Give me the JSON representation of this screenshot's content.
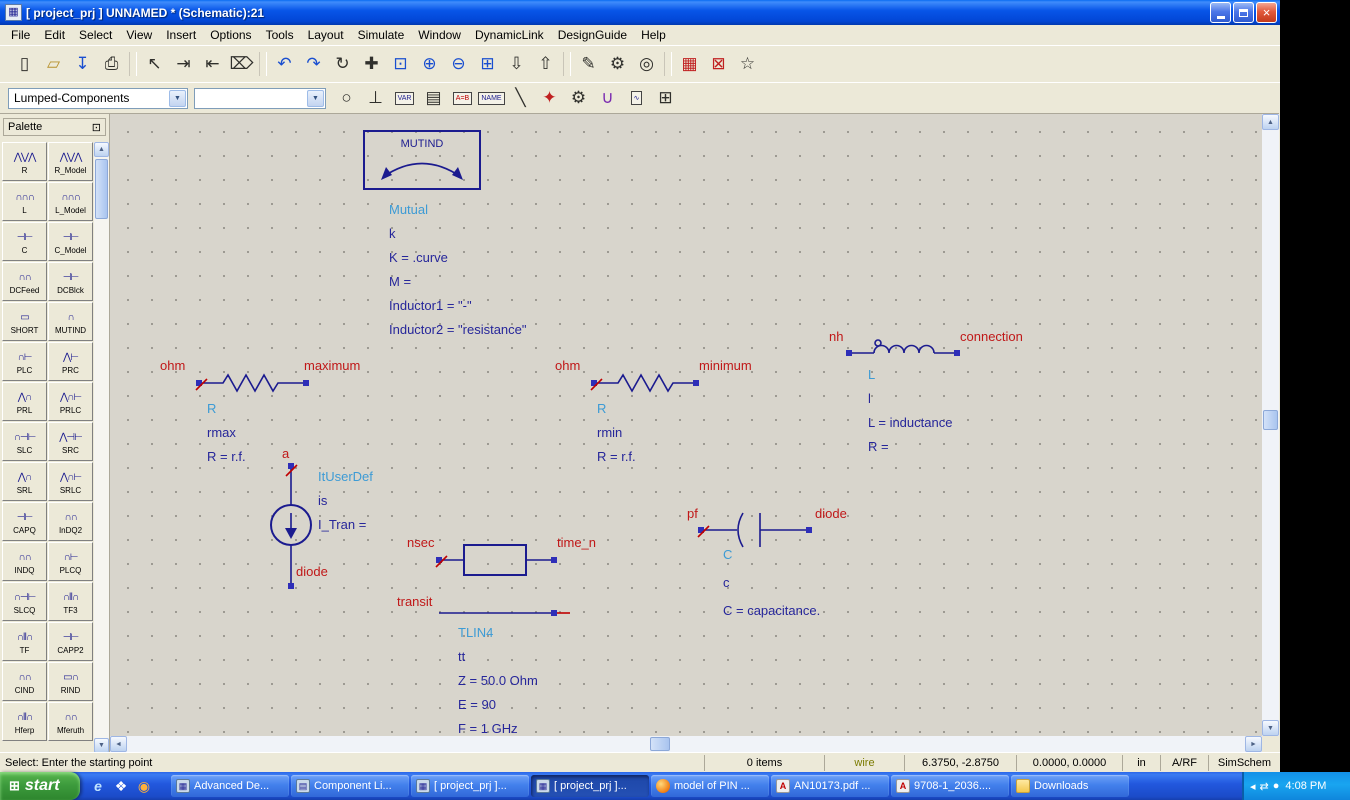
{
  "window": {
    "title": "[ project_prj ] UNNAMED * (Schematic):21"
  },
  "menu": {
    "items": [
      "File",
      "Edit",
      "Select",
      "View",
      "Insert",
      "Options",
      "Tools",
      "Layout",
      "Simulate",
      "Window",
      "DynamicLink",
      "DesignGuide",
      "Help"
    ]
  },
  "toolbar1": {
    "icons": [
      {
        "name": "new-design-icon",
        "glyph": "▯"
      },
      {
        "name": "open-design-icon",
        "glyph": "▱",
        "cls": "amber"
      },
      {
        "name": "save-design-icon",
        "glyph": "↧",
        "cls": "blue"
      },
      {
        "name": "print-icon",
        "glyph": "⎙"
      },
      {
        "name": "separator",
        "glyph": "",
        "cls": "sep"
      },
      {
        "name": "select-pointer-icon",
        "glyph": "↖"
      },
      {
        "name": "insert-pin-icon",
        "glyph": "⇥"
      },
      {
        "name": "insert-pin2-icon",
        "glyph": "⇤"
      },
      {
        "name": "delete-icon",
        "glyph": "⌦"
      },
      {
        "name": "separator",
        "glyph": "",
        "cls": "sep"
      },
      {
        "name": "undo-icon",
        "glyph": "↶",
        "cls": "blue"
      },
      {
        "name": "redo-icon",
        "glyph": "↷",
        "cls": "blue"
      },
      {
        "name": "rotate-icon",
        "glyph": "↻"
      },
      {
        "name": "move-icon",
        "glyph": "✚"
      },
      {
        "name": "zoom-area-icon",
        "glyph": "⊡",
        "cls": "blue"
      },
      {
        "name": "zoom-in-icon",
        "glyph": "⊕",
        "cls": "blue"
      },
      {
        "name": "zoom-out-icon",
        "glyph": "⊖",
        "cls": "blue"
      },
      {
        "name": "zoom-fit-icon",
        "glyph": "⊞",
        "cls": "blue"
      },
      {
        "name": "push-into-hierarchy-icon",
        "glyph": "⇩"
      },
      {
        "name": "pop-out-hierarchy-icon",
        "glyph": "⇧"
      },
      {
        "name": "separator",
        "glyph": "",
        "cls": "sep"
      },
      {
        "name": "insert-wire-icon",
        "glyph": "✎"
      },
      {
        "name": "simulate-icon",
        "glyph": "⚙"
      },
      {
        "name": "find-icon",
        "glyph": "◎"
      },
      {
        "name": "separator",
        "glyph": "",
        "cls": "sep"
      },
      {
        "name": "deactivate-component-icon",
        "glyph": "▦",
        "cls": "red"
      },
      {
        "name": "deactivate-delete-icon",
        "glyph": "⊠",
        "cls": "red"
      },
      {
        "name": "wand-icon",
        "glyph": "☆"
      }
    ]
  },
  "toolbar2": {
    "palette_combo": "Lumped-Components",
    "history_combo": "",
    "icons": [
      {
        "name": "oval-shape-icon",
        "glyph": "○"
      },
      {
        "name": "ground-icon",
        "glyph": "⊥"
      },
      {
        "name": "var-icon",
        "glyph": "VAR",
        "cls": "boxed"
      },
      {
        "name": "display-icon",
        "glyph": "▤"
      },
      {
        "name": "equation-icon",
        "glyph": "A=B",
        "cls": "boxedred"
      },
      {
        "name": "name-node-icon",
        "glyph": "NAME",
        "cls": "boxed"
      },
      {
        "name": "wire-icon",
        "glyph": "╲"
      },
      {
        "name": "port-icon",
        "glyph": "✦",
        "cls": "red"
      },
      {
        "name": "gear-icon",
        "glyph": "⚙"
      },
      {
        "name": "probe-icon",
        "glyph": "∪",
        "cls": "purple"
      },
      {
        "name": "wave-icon",
        "glyph": "∿",
        "cls": "boxed"
      },
      {
        "name": "library-browser-icon",
        "glyph": "⊞"
      }
    ]
  },
  "palette": {
    "title": "Palette",
    "items": [
      {
        "label": "R",
        "glyph": "⋀⋁⋀"
      },
      {
        "label": "R_Model",
        "glyph": "⋀⋁⋀"
      },
      {
        "label": "L",
        "glyph": "∩∩∩"
      },
      {
        "label": "L_Model",
        "glyph": "∩∩∩"
      },
      {
        "label": "C",
        "glyph": "⊣⊢"
      },
      {
        "label": "C_Model",
        "glyph": "⊣⊢"
      },
      {
        "label": "DCFeed",
        "glyph": "∩∩"
      },
      {
        "label": "DCBlck",
        "glyph": "⊣⊢"
      },
      {
        "label": "SHORT",
        "glyph": "▭"
      },
      {
        "label": "MUTIND",
        "glyph": "∩"
      },
      {
        "label": "PLC",
        "glyph": "∩⊢"
      },
      {
        "label": "PRC",
        "glyph": "⋀⊢"
      },
      {
        "label": "PRL",
        "glyph": "⋀∩"
      },
      {
        "label": "PRLC",
        "glyph": "⋀∩⊢"
      },
      {
        "label": "SLC",
        "glyph": "∩⊣⊢"
      },
      {
        "label": "SRC",
        "glyph": "⋀⊣⊢"
      },
      {
        "label": "SRL",
        "glyph": "⋀∩"
      },
      {
        "label": "SRLC",
        "glyph": "⋀∩⊢"
      },
      {
        "label": "CAPQ",
        "glyph": "⊣⊢"
      },
      {
        "label": "InDQ2",
        "glyph": "∩∩"
      },
      {
        "label": "INDQ",
        "glyph": "∩∩"
      },
      {
        "label": "PLCQ",
        "glyph": "∩⊢"
      },
      {
        "label": "SLCQ",
        "glyph": "∩⊣⊢"
      },
      {
        "label": "TF3",
        "glyph": "∩‖∩"
      },
      {
        "label": "TF",
        "glyph": "∩‖∩"
      },
      {
        "label": "CAPP2",
        "glyph": "⊣⊢"
      },
      {
        "label": "CIND",
        "glyph": "∩∩"
      },
      {
        "label": "RIND",
        "glyph": "▭∩"
      },
      {
        "label": "Hferp",
        "glyph": "∩‖∩"
      },
      {
        "label": "Mferuth",
        "glyph": "∩∩"
      }
    ]
  },
  "schematic": {
    "mutind": {
      "box_label": "MUTIND",
      "name": "Mutual",
      "lines": [
        "k",
        "K = .curve",
        "M =",
        "Inductor1 = \"-\"",
        "Inductor2 = \"resistance\""
      ]
    },
    "r1": {
      "pin_left": "ohm",
      "pin_right": "maximum",
      "name": "R",
      "lines": [
        "rmax",
        "R = r.f."
      ]
    },
    "r2": {
      "pin_left": "ohm",
      "pin_right": "minimum",
      "name": "R",
      "lines": [
        "rmin",
        "R = r.f."
      ]
    },
    "l1": {
      "pin_left": "nh",
      "pin_right": "connection",
      "name": "L",
      "lines": [
        "l",
        "L = inductance",
        "R ="
      ]
    },
    "isrc": {
      "pin_top": "a",
      "pin_bottom": "diode",
      "name": "ItUserDef",
      "lines": [
        "is",
        "I_Tran ="
      ]
    },
    "tlin": {
      "pin_left": "nsec",
      "pin_right": "time_n",
      "pin_left2": "transit",
      "name": "TLIN4",
      "lines": [
        "tt",
        "Z = 50.0 Ohm",
        "E = 90",
        "F = 1 GHz"
      ]
    },
    "c1": {
      "pin_left": "pf",
      "pin_right": "diode",
      "name": "C",
      "lines": [
        "c",
        "C = capacitance."
      ]
    }
  },
  "statusbar": {
    "message": "Select: Enter the starting point",
    "items": "0 items",
    "mode": "wire",
    "coord1": "6.3750, -2.8750",
    "coord2": "0.0000, 0.0000",
    "units": "in",
    "tech": "A/RF",
    "tool": "SimSchem"
  },
  "taskbar": {
    "start_label": "start",
    "start_flag": "⊞",
    "quicklaunch": [
      {
        "name": "quicklaunch-internet-explorer-icon",
        "glyph": "e",
        "cls": "ie"
      },
      {
        "name": "quicklaunch-app-icon",
        "glyph": "❖",
        "cls": ""
      },
      {
        "name": "quicklaunch-firefox-icon",
        "glyph": "◉",
        "cls": "orange"
      }
    ],
    "tasks": [
      {
        "label": "Advanced De...",
        "icon": "ads",
        "glyph": "▦",
        "state": ""
      },
      {
        "label": "Component Li...",
        "icon": "ads",
        "glyph": "▤",
        "state": ""
      },
      {
        "label": "[ project_prj ]...",
        "icon": "ads",
        "glyph": "▦",
        "state": ""
      },
      {
        "label": "[ project_prj ]...",
        "icon": "ads",
        "glyph": "▦",
        "state": "active"
      },
      {
        "label": "model of PIN ...",
        "icon": "firefox",
        "glyph": "",
        "state": ""
      },
      {
        "label": "AN10173.pdf ...",
        "icon": "pdf",
        "glyph": "A",
        "state": ""
      },
      {
        "label": "9708-1_2036....",
        "icon": "pdf",
        "glyph": "A",
        "state": ""
      },
      {
        "label": "Downloads",
        "icon": "folder",
        "glyph": "",
        "state": ""
      }
    ],
    "tray_icons": [
      {
        "name": "tray-hidden-icons-chevron",
        "glyph": "◂"
      },
      {
        "name": "tray-network-icon",
        "glyph": "⇄"
      },
      {
        "name": "tray-status-icon",
        "glyph": "●"
      }
    ],
    "time": "4:08 PM"
  }
}
